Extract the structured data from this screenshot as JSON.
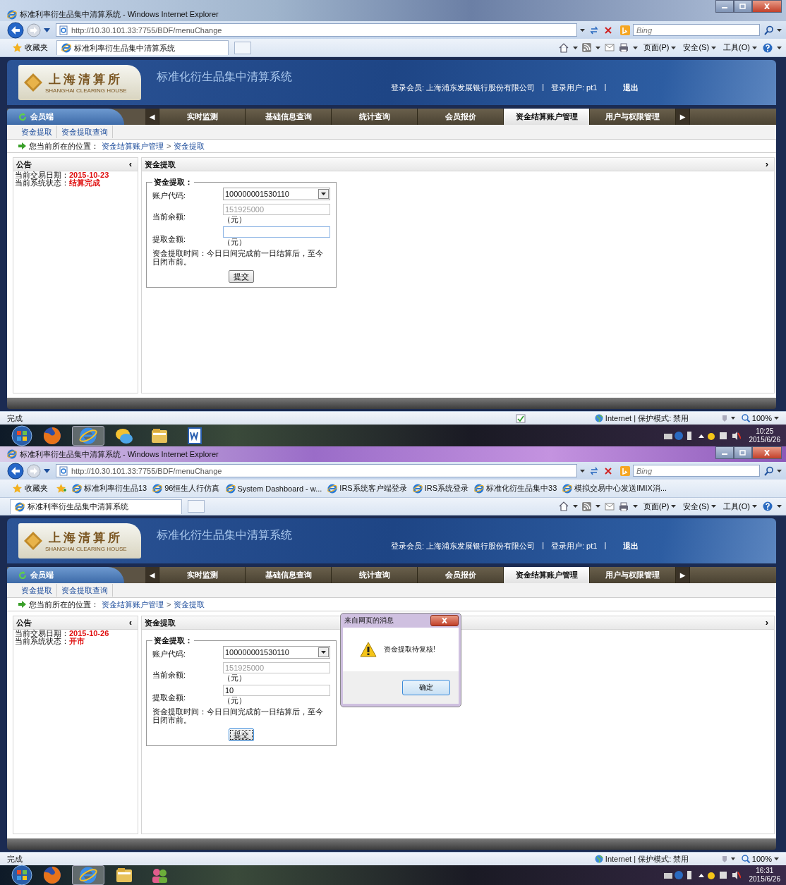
{
  "screens": [
    {
      "window": {
        "title": "标准利率衍生品集中清算系统 - Windows Internet Explorer",
        "address": "http://10.30.101.33:7755/BDF/menuChange",
        "search_placeholder": "Bing"
      },
      "favorites_label": "收藏夹",
      "tab_title": "标准利率衍生品集中清算系统",
      "commands": [
        "页面(P)",
        "安全(S)",
        "工具(O)"
      ],
      "header": {
        "logo_text": "上海清算所",
        "logo_subtext": "SHANGHAI CLEARING HOUSE",
        "system_title": "标准化衍生品集中清算系统",
        "member": "登录会员: 上海浦东发展银行股份有限公司",
        "sep": "|",
        "user": "登录用户: pt1",
        "logout": "退出"
      },
      "nav": {
        "role_tab": "会员端",
        "prev": "◀",
        "next": "▶",
        "items": [
          {
            "label": "实时监测",
            "selected": false
          },
          {
            "label": "基础信息查询",
            "selected": false
          },
          {
            "label": "统计查询",
            "selected": false
          },
          {
            "label": "会员报价",
            "selected": false
          },
          {
            "label": "资金结算账户管理",
            "selected": true
          },
          {
            "label": "用户与权限管理",
            "selected": false
          }
        ]
      },
      "subtabs": [
        "资金提取",
        "资金提取查询"
      ],
      "breadcrumb": {
        "label": "您当前所在的位置：",
        "path": [
          "资金结算账户管理",
          "资金提取"
        ],
        "separator": ">"
      },
      "notice_panel": {
        "title": "公告",
        "toggle": "‹",
        "lines": [
          {
            "label": "当前交易日期：",
            "value": "2015-10-23"
          },
          {
            "label": "当前系统状态：",
            "value": "结算完成"
          }
        ]
      },
      "main_panel": {
        "title": "资金提取",
        "toggle": "›",
        "form": {
          "legend": "资金提取：",
          "fields": [
            {
              "kind": "select",
              "label": "账户代码:",
              "value": "100000001530110"
            },
            {
              "kind": "readonly",
              "label": "当前余额:",
              "value": "151925000",
              "disabled": true,
              "unit": "（元）"
            },
            {
              "kind": "input",
              "label": "提取金额:",
              "focused": true,
              "unit": "（元）"
            }
          ],
          "note": "资金提取时间：今日日间完成前一日结算后，至今日闭市前。",
          "submit": {
            "label": "提交",
            "focused": false
          }
        }
      },
      "status_bar": {
        "text": "完成",
        "zone": "Internet | 保护模式: 禁用",
        "zoom": "100%",
        "page_check": true
      },
      "taskbar": {
        "apps": [
          {
            "kind": "firefox",
            "selected": false
          },
          {
            "kind": "browser",
            "selected": true
          },
          {
            "kind": "messenger",
            "selected": false
          },
          {
            "kind": "folder",
            "selected": false
          },
          {
            "kind": "word",
            "selected": false
          }
        ],
        "time": "10:25",
        "date": "2015/6/26"
      }
    },
    {
      "window": {
        "title": "标准利率衍生品集中清算系统 - Windows Internet Explorer",
        "address": "http://10.30.101.33:7755/BDF/menuChange",
        "search_placeholder": "Bing"
      },
      "favorites_label": "收藏夹",
      "links": [
        "标准利率衍生品13",
        "96恒生人行仿真",
        "System Dashboard - w...",
        "IRS系统客户端登录",
        "IRS系统登录",
        "标准化衍生品集中33",
        "模拟交易中心发送IMIX消..."
      ],
      "tab_title": "标准利率衍生品集中清算系统",
      "commands": [
        "页面(P)",
        "安全(S)",
        "工具(O)"
      ],
      "header": {
        "logo_text": "上海清算所",
        "logo_subtext": "SHANGHAI CLEARING HOUSE",
        "system_title": "标准化衍生品集中清算系统",
        "member": "登录会员: 上海浦东发展银行股份有限公司",
        "sep": "|",
        "user": "登录用户: pt1",
        "logout": "退出"
      },
      "nav": {
        "role_tab": "会员端",
        "prev": "◀",
        "next": "▶",
        "items": [
          {
            "label": "实时监测",
            "selected": false
          },
          {
            "label": "基础信息查询",
            "selected": false
          },
          {
            "label": "统计查询",
            "selected": false
          },
          {
            "label": "会员报价",
            "selected": false
          },
          {
            "label": "资金结算账户管理",
            "selected": true
          },
          {
            "label": "用户与权限管理",
            "selected": false
          }
        ]
      },
      "subtabs": [
        "资金提取",
        "资金提取查询"
      ],
      "breadcrumb": {
        "label": "您当前所在的位置：",
        "path": [
          "资金结算账户管理",
          "资金提取"
        ],
        "separator": ">"
      },
      "notice_panel": {
        "title": "公告",
        "toggle": "‹",
        "lines": [
          {
            "label": "当前交易日期：",
            "value": "2015-10-26"
          },
          {
            "label": "当前系统状态：",
            "value": "开市"
          }
        ]
      },
      "main_panel": {
        "title": "资金提取",
        "toggle": "›",
        "form": {
          "legend": "资金提取：",
          "fields": [
            {
              "kind": "select",
              "label": "账户代码:",
              "value": "100000001530110"
            },
            {
              "kind": "readonly",
              "label": "当前余额:",
              "value": "151925000",
              "disabled": true,
              "unit": "（元）"
            },
            {
              "kind": "input",
              "label": "提取金额:",
              "value": "10",
              "focused": false,
              "unit": "（元）"
            }
          ],
          "note": "资金提取时间：今日日间完成前一日结算后，至今日闭市前。",
          "submit": {
            "label": "提交",
            "focused": true
          }
        }
      },
      "dialog": {
        "title": "来自网页的消息",
        "message": "资金提取待复核!",
        "button": "确定"
      },
      "status_bar": {
        "text": "完成",
        "zone": "Internet | 保护模式: 禁用",
        "zoom": "100%",
        "page_check": false
      },
      "taskbar": {
        "apps": [
          {
            "kind": "firefox",
            "selected": false
          },
          {
            "kind": "browser",
            "selected": true
          },
          {
            "kind": "folder",
            "selected": false
          },
          {
            "kind": "people",
            "selected": false
          }
        ],
        "time": "16:31",
        "date": "2015/6/26"
      }
    }
  ]
}
